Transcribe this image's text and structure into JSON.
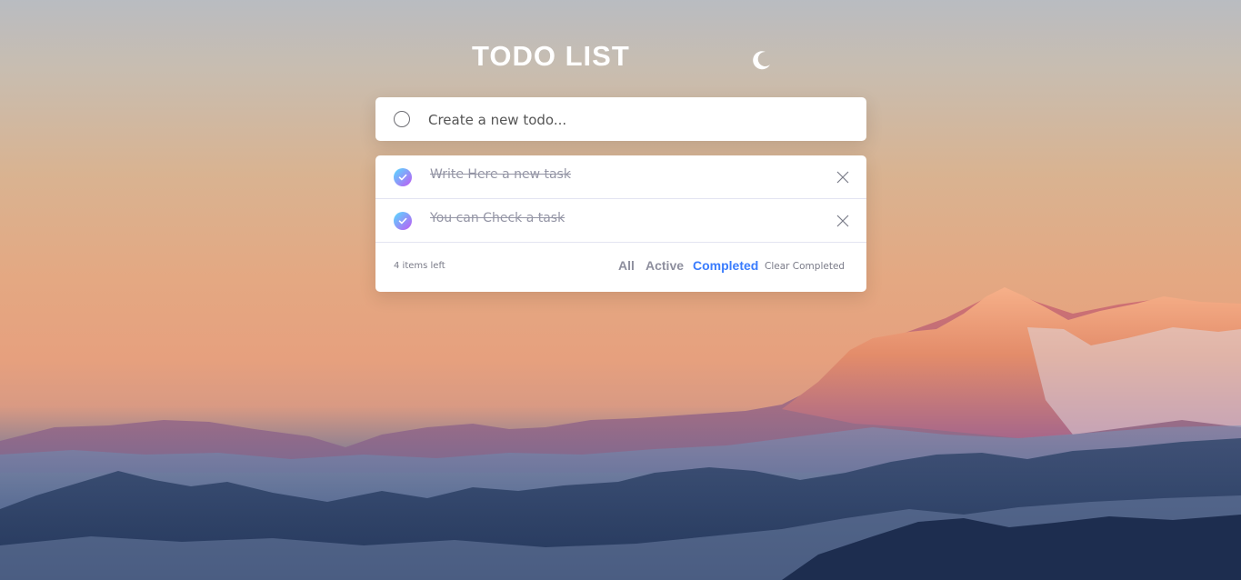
{
  "app": {
    "title": "TODO LIST",
    "theme_icon": "moon-icon"
  },
  "new_todo": {
    "placeholder": "Create a new todo..."
  },
  "todos": [
    {
      "text": "Write Here a new task",
      "completed": true
    },
    {
      "text": "You can Check a task",
      "completed": true
    }
  ],
  "footer": {
    "items_left": "4 items left",
    "filters": {
      "all": "All",
      "active": "Active",
      "completed": "Completed"
    },
    "selected_filter": "Completed",
    "clear_label": "Clear Completed"
  },
  "colors": {
    "accent": "#3a7cfd",
    "check_gradient_start": "#55ddff",
    "check_gradient_end": "#c058f3",
    "completed_text": "#9495a5"
  }
}
